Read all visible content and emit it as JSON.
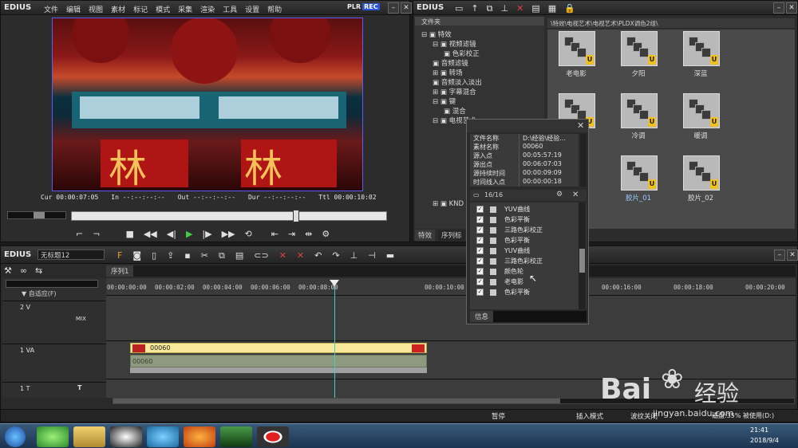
{
  "app_name": "EDIUS",
  "player": {
    "menu": [
      "文件",
      "编辑",
      "视图",
      "素材",
      "标记",
      "模式",
      "采集",
      "渲染",
      "工具",
      "设置",
      "帮助"
    ],
    "plr": "PLR",
    "rec": "REC",
    "timecodes": [
      {
        "label": "Cur",
        "value": "00:00:07:05"
      },
      {
        "label": "In",
        "value": "--:--:--:--"
      },
      {
        "label": "Out",
        "value": "--:--:--:--"
      },
      {
        "label": "Dur",
        "value": "--:--:--:--"
      },
      {
        "label": "Ttl",
        "value": "00:00:10:02"
      }
    ],
    "scrub_position": 0.71
  },
  "effects": {
    "title": "EDIUS",
    "folder_header": "文件夹",
    "path": "\\特效\\电视艺术\\电视艺术\\PLDX调色2组\\",
    "tree": [
      "特效",
      "视频滤镜",
      "色彩校正",
      "音频滤镜",
      "转场",
      "音频淡入淡出",
      "字幕混合",
      "键",
      "混合",
      "电视艺术",
      "KND"
    ],
    "thumbs": [
      "老电影",
      "夕阳",
      "深蓝",
      "",
      "冷调",
      "暖调",
      "",
      "胶片_01",
      "胶片_02"
    ],
    "tabs": [
      "特效",
      "序列标"
    ]
  },
  "info_panel": {
    "rows": [
      {
        "k": "文件名称",
        "v": "D:\\经验\\经验..."
      },
      {
        "k": "素材名称",
        "v": "00060"
      },
      {
        "k": "源入点",
        "v": "00:05:57:19"
      },
      {
        "k": "源出点",
        "v": "00:06:07:03"
      },
      {
        "k": "源持续时间",
        "v": "00:00:09:09"
      },
      {
        "k": "时间线入点",
        "v": "00:00:00:18"
      }
    ],
    "count": "16/16",
    "filters": [
      "YUV曲线",
      "色彩平衡",
      "三路色彩校正",
      "色彩平衡",
      "YUV曲线",
      "三路色彩校正",
      "颜色轮",
      "老电影",
      "色彩平衡"
    ],
    "tab": "信息"
  },
  "timeline": {
    "title": "EDIUS",
    "project_name": "无标题12",
    "sequence_tab": "序列1",
    "ruler": [
      "00:00:00:00",
      "00:00:02:00",
      "00:00:04:00",
      "00:00:06:00",
      "00:00:08:00",
      "00:00:10:00",
      "00:00:16:00",
      "00:00:18:00",
      "00:00:20:00"
    ],
    "fit_label": "自适应(F)",
    "tracks": [
      {
        "name": "2 V",
        "extra": "MIX"
      },
      {
        "name": "1 VA",
        "extra": ""
      },
      {
        "name": "1 T",
        "extra": ""
      }
    ],
    "clip_name": "00060",
    "clip_name_audio": "00060",
    "status": [
      "暂停",
      "插入模式",
      "波纹关闭",
      "磁盘:35% 被使用(D:)"
    ]
  },
  "taskbar": {
    "time": "21:41",
    "date": "2018/9/4"
  },
  "watermark": {
    "brand": "Bai",
    "brand2": "经验",
    "url": "jingyan.baidu.com"
  }
}
